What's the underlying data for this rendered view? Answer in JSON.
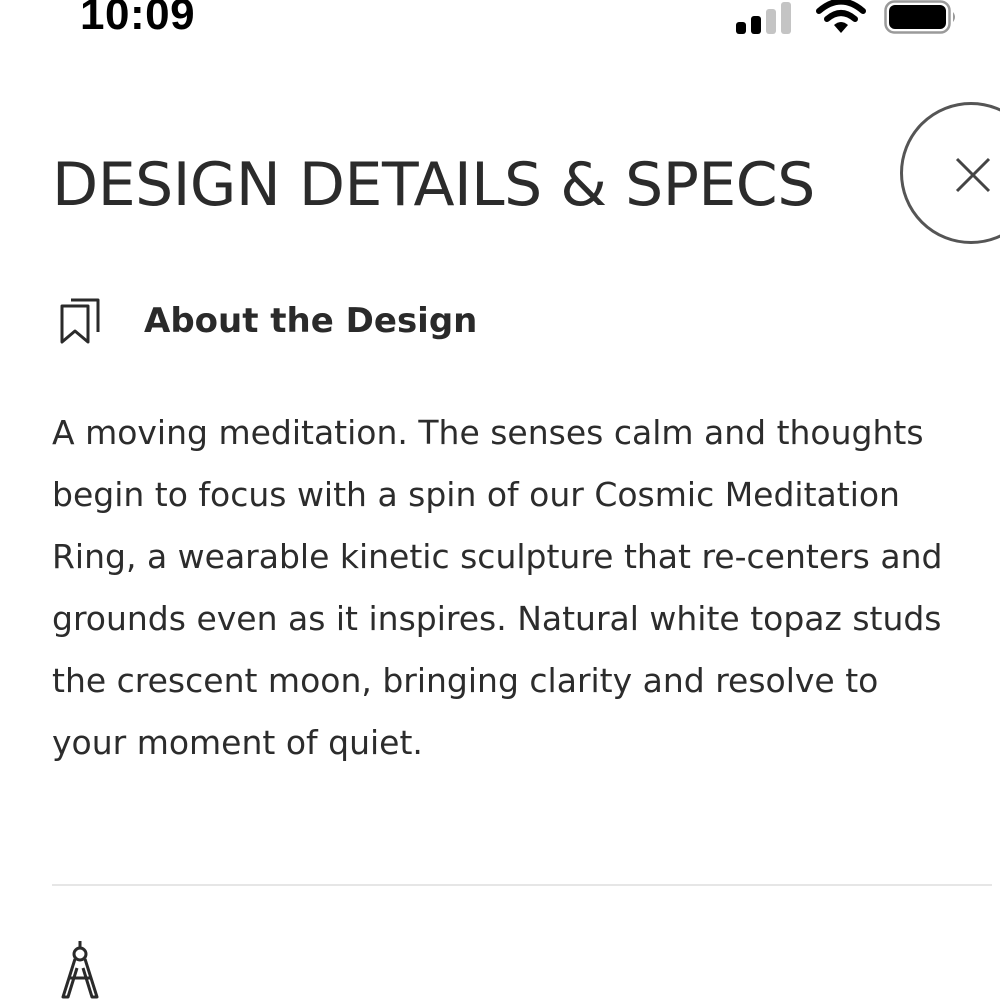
{
  "status_bar": {
    "time": "10:09",
    "signal_icon": "cellular-signal-icon",
    "signal_strength": 0.5,
    "wifi_icon": "wifi-icon",
    "battery_icon": "battery-icon",
    "battery_level": 1.0
  },
  "header": {
    "title": "DESIGN DETAILS & SPECS",
    "close_icon": "close-icon"
  },
  "about_section": {
    "icon": "bookmark-icon",
    "title": "About the Design",
    "description": "A moving meditation. The senses calm and thoughts begin to focus with a spin of our Cosmic Meditation Ring, a wearable kinetic sculpture that re-centers and grounds even as it inspires. Natural white topaz studs the crescent moon, bringing clarity and resolve to your moment of quiet."
  },
  "next_section": {
    "icon": "drafting-compass-icon"
  },
  "colors": {
    "text": "#2a2a2a",
    "divider": "#e6e6e6",
    "background": "#ffffff"
  }
}
